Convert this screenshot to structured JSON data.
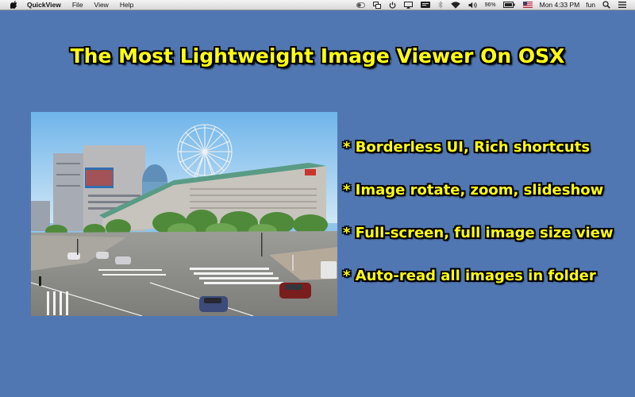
{
  "menubar": {
    "app_name": "QuickView",
    "menus": [
      "File",
      "View",
      "Help"
    ],
    "battery_percent": "96%",
    "datetime": "Mon 4:33 PM",
    "user": "fun"
  },
  "headline": "The Most Lightweight Image Viewer On OSX",
  "features": [
    "* Borderless UI, Rich shortcuts",
    "* Image rotate, zoom, slideshow",
    "* Full-screen, full image size view",
    "* Auto-read all images in folder"
  ],
  "colors": {
    "background": "#5177b3",
    "headline_text": "#ffff14",
    "text_outline": "#000000"
  },
  "icons": {
    "apple": "apple-icon",
    "status": [
      "toggle-icon",
      "screens-icon",
      "power-icon",
      "airplay-icon",
      "display-icon",
      "bluetooth-icon",
      "wifi-icon",
      "volume-icon",
      "battery-icon",
      "flag-icon",
      "search-icon",
      "list-icon"
    ]
  }
}
